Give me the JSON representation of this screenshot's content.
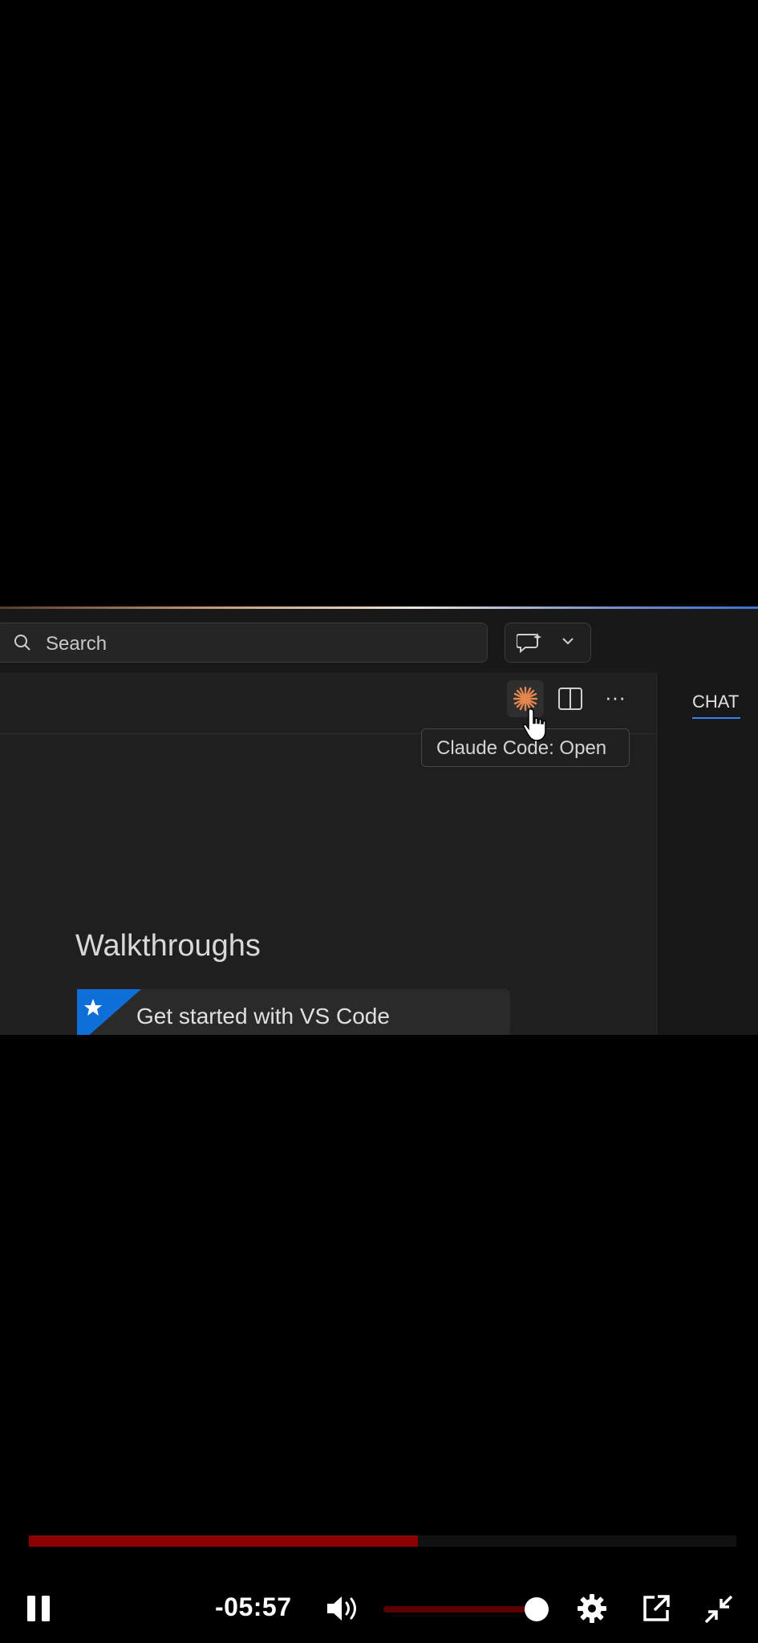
{
  "vscode": {
    "search": {
      "placeholder": "Search"
    },
    "toolbar": {
      "claude_icon": "claude-asterisk-icon",
      "split_icon": "split-editor-icon",
      "more_label": "···"
    },
    "tooltip": "Claude Code: Open",
    "welcome": {
      "section_title": "Walkthroughs",
      "walkthrough_item": "Get started with VS Code"
    },
    "side_panel": {
      "tab": "CHAT"
    },
    "colors": {
      "claude_orange": "#e5864f",
      "accent_blue": "#3b82f6"
    }
  },
  "player": {
    "time_remaining": "-05:57",
    "progress_fraction": 0.55,
    "volume_fraction": 1.0,
    "colors": {
      "progress": "#8b0000",
      "knob": "#ffffff"
    },
    "icons": [
      "pause-icon",
      "volume-icon",
      "gear-icon",
      "popout-icon",
      "exit-fullscreen-icon"
    ]
  }
}
